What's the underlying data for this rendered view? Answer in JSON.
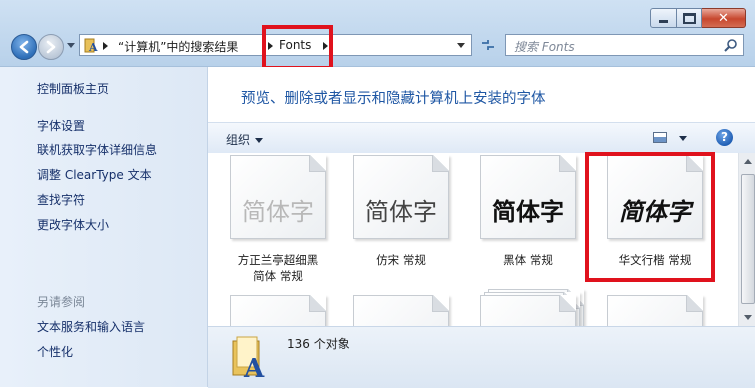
{
  "window": {
    "controls": {
      "minimize_icon": "minimize-icon",
      "maximize_icon": "maximize-icon",
      "close_icon": "close-icon",
      "close_glyph": "✕"
    }
  },
  "address_bar": {
    "breadcrumbs": [
      "“计算机”中的搜索结果",
      "Fonts"
    ],
    "folder_icon": "fonts-folder-icon"
  },
  "search": {
    "placeholder": "搜索 Fonts",
    "icon": "search-icon"
  },
  "nav_pane": {
    "home_link": "控制面板主页",
    "links": [
      "字体设置",
      "联机获取字体详细信息",
      "调整 ClearType 文本",
      "查找字符",
      "更改字体大小"
    ],
    "see_also_heading": "另请参阅",
    "see_also_links": [
      "文本服务和输入语言",
      "个性化"
    ]
  },
  "content": {
    "title": "预览、删除或者显示和隐藏计算机上安装的字体"
  },
  "toolbar": {
    "organize_label": "组织",
    "help_glyph": "?"
  },
  "fonts": [
    {
      "sample": "简体字",
      "caption_line1": "方正兰亭超细黑",
      "caption_line2": "简体 常规"
    },
    {
      "sample": "简体字",
      "caption_line1": "仿宋 常规",
      "caption_line2": ""
    },
    {
      "sample": "简体字",
      "caption_line1": "黑体 常规",
      "caption_line2": ""
    },
    {
      "sample": "简体字",
      "caption_line1": "华文行楷 常规",
      "caption_line2": ""
    }
  ],
  "details": {
    "count": "136 个对象"
  },
  "colors": {
    "highlight": "#e0121d",
    "link": "#16306a",
    "title": "#1f57a4"
  }
}
